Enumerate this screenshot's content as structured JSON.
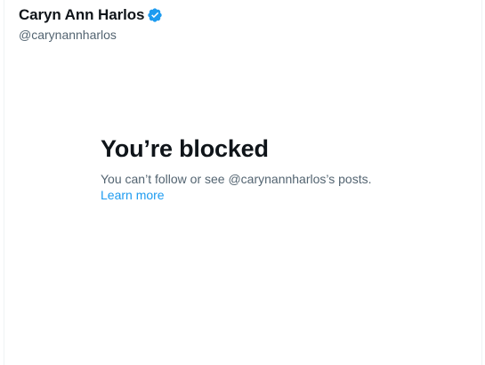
{
  "profile": {
    "display_name": "Caryn Ann Harlos",
    "verified_icon": "verified-badge-icon",
    "handle": "@carynannharlos"
  },
  "blocked": {
    "title": "You’re blocked",
    "description": "You can’t follow or see @carynannharlos’s posts.",
    "learn_more_label": "Learn more"
  },
  "colors": {
    "text_primary": "#0f1419",
    "text_secondary": "#536471",
    "accent": "#1d9bf0"
  }
}
